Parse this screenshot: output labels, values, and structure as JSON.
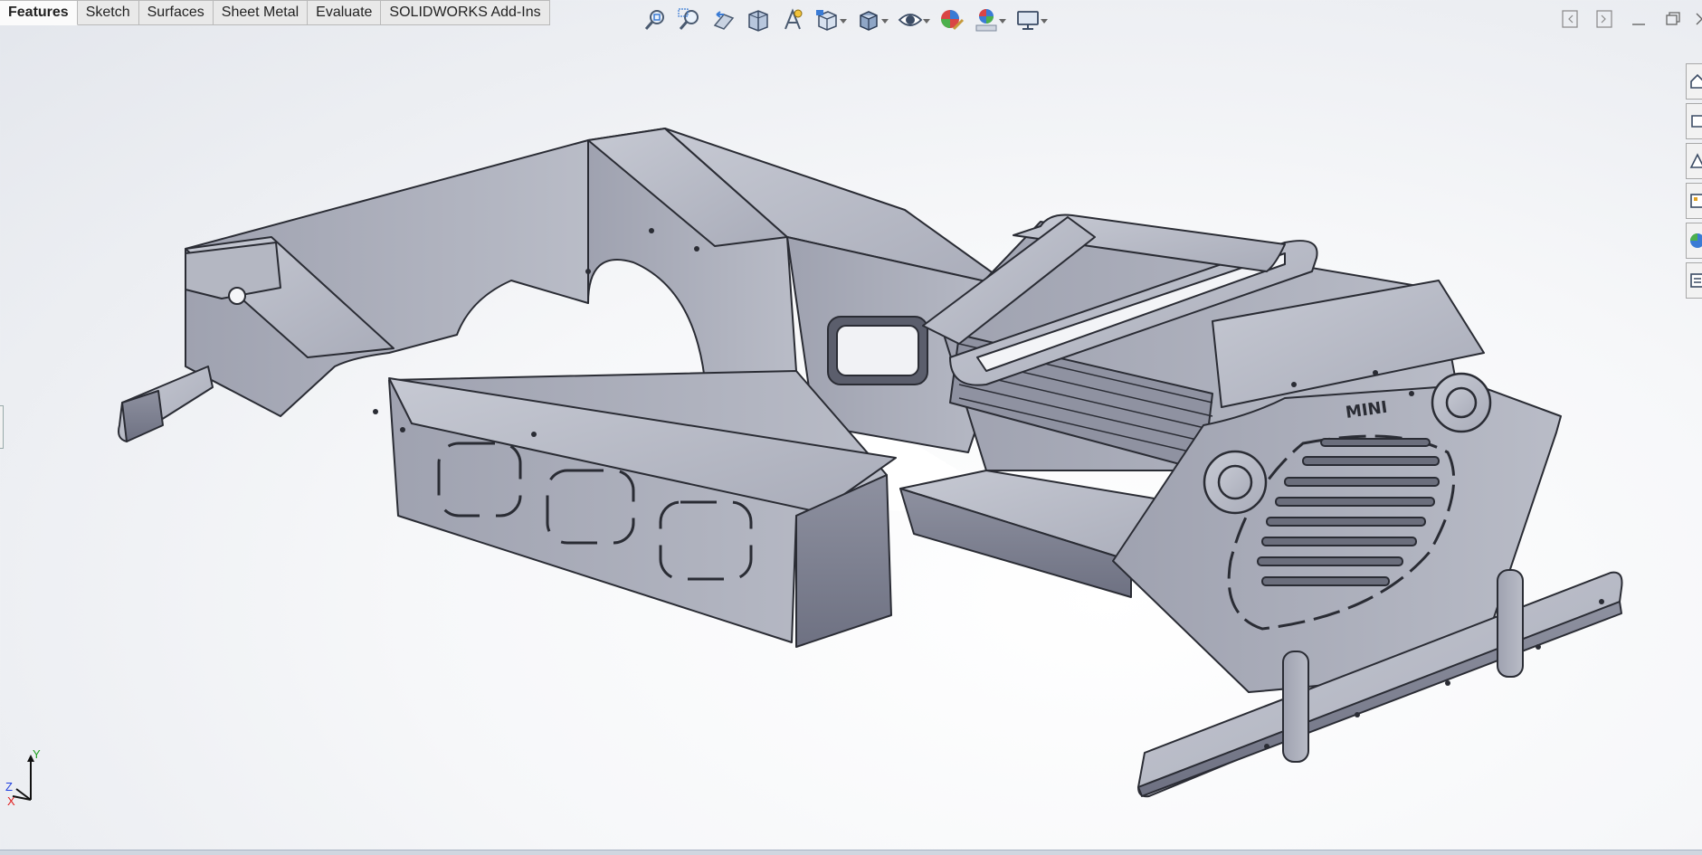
{
  "command_manager": {
    "tabs": [
      {
        "label": "Features",
        "active": true
      },
      {
        "label": "Sketch",
        "active": false
      },
      {
        "label": "Surfaces",
        "active": false
      },
      {
        "label": "Sheet Metal",
        "active": false
      },
      {
        "label": "Evaluate",
        "active": false
      },
      {
        "label": "SOLIDWORKS Add-Ins",
        "active": false
      }
    ]
  },
  "heads_up_toolbar": {
    "icons": [
      "zoom-to-fit-icon",
      "zoom-to-area-icon",
      "previous-view-icon",
      "section-view-icon",
      "dynamic-annotation-icon",
      "view-orientation-icon",
      "display-style-icon",
      "hide-show-items-icon",
      "edit-appearance-icon",
      "apply-scene-icon",
      "view-settings-icon"
    ]
  },
  "model": {
    "emblem_text": "MINI"
  },
  "triad": {
    "x_label": "X",
    "y_label": "Y",
    "z_label": "Z",
    "x_color": "#e02020",
    "y_color": "#20a020",
    "z_color": "#2040e0"
  },
  "colors": {
    "metal_light": "#b9bcc6",
    "metal_mid": "#9a9dab",
    "metal_dark": "#6d7080",
    "edge": "#2a2c34"
  }
}
